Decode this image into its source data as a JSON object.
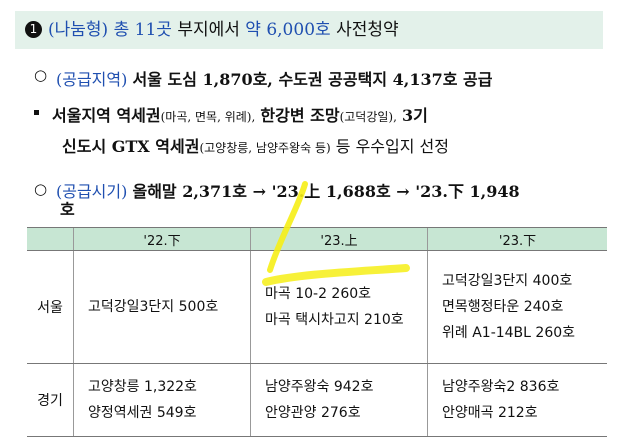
{
  "headline": {
    "num": "1",
    "label": "(나눔형)",
    "count": "총 11곳",
    "mid": "부지에서",
    "amount": "약 6,000호",
    "tail": "사전청약"
  },
  "bullet1": {
    "label": "(공급지역)",
    "text": "서울 도심 1,870호, 수도권 공공택지 4,137호 공급"
  },
  "bullet2": {
    "part1": "서울지역 역세권",
    "part1_note": "(마곡, 면목, 위례),",
    "part2": "한강변 조망",
    "part2_note": "(고덕강일),",
    "part3": "3기",
    "line2_a": "신도시 GTX 역세권",
    "line2_note": "(고양창릉, 남양주왕숙 등)",
    "line2_b": "등 우수입지 선정"
  },
  "bullet3": {
    "label": "(공급시기)",
    "text": "올해말 2,371호 → '23.上 1,688호 → '23.下 1,948",
    "wrap": "호"
  },
  "table": {
    "headers": [
      "",
      "'22.下",
      "'23.上",
      "'23.下"
    ],
    "rows": [
      {
        "region": "서울",
        "cells": [
          [
            "고덕강일3단지 500호"
          ],
          [
            "마곡 10-2 260호",
            "마곡 택시차고지 210호"
          ],
          [
            "고덕강일3단지 400호",
            "면목행정타운 240호",
            "위례 A1-14BL 260호"
          ]
        ]
      },
      {
        "region": "경기",
        "cells": [
          [
            "고양창릉 1,322호",
            "양정역세권 549호"
          ],
          [
            "남양주왕숙 942호",
            "안양관양 276호"
          ],
          [
            "남양주왕숙2 836호",
            "안양매곡 212호"
          ]
        ]
      }
    ]
  },
  "colors": {
    "headline_bg": "#e3f1ea",
    "table_header_bg": "#c7e6d3",
    "accent_blue": "#1f4fb0",
    "highlighter": "#f6ee16"
  }
}
